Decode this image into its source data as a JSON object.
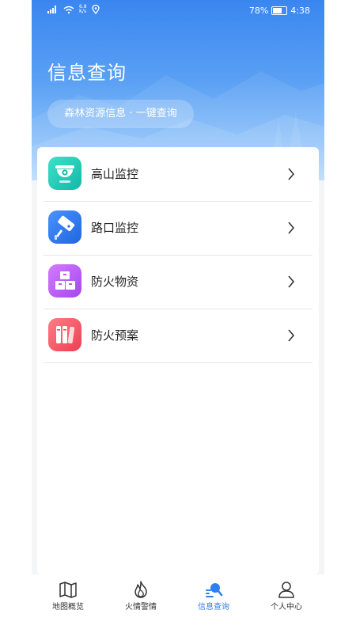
{
  "status_bar": {
    "battery_text": "78%",
    "time": "4:38",
    "speed_value": "6.8",
    "speed_unit": "K/s",
    "battery_level": 0.78
  },
  "header": {
    "title": "信息查询",
    "subtitle": "森林资源信息 · 一键查询"
  },
  "menu": [
    {
      "label": "高山监控",
      "icon": "dome-camera-icon"
    },
    {
      "label": "路口监控",
      "icon": "cctv-camera-icon"
    },
    {
      "label": "防火物资",
      "icon": "boxes-icon"
    },
    {
      "label": "防火预案",
      "icon": "books-icon"
    }
  ],
  "nav": [
    {
      "label": "地图概览",
      "icon": "map-icon"
    },
    {
      "label": "火情警情",
      "icon": "flame-icon"
    },
    {
      "label": "信息查询",
      "icon": "search-document-icon",
      "active": true
    },
    {
      "label": "个人中心",
      "icon": "person-icon"
    }
  ],
  "colors": {
    "accent": "#2f7df2",
    "header_top": "#3a86f0",
    "icon_teal": "#1fc9b4",
    "icon_blue": "#2b7cf0",
    "icon_purple": "#b85ef0",
    "icon_red": "#f45a62"
  }
}
